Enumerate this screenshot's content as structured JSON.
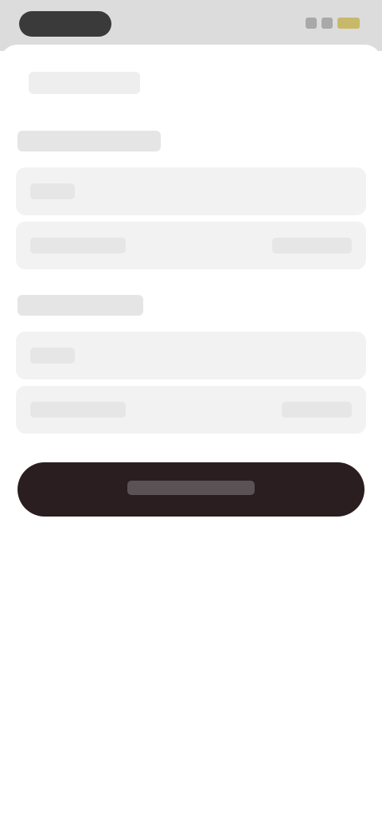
{
  "status_bar": {
    "time": ""
  },
  "top_row": {
    "label": ""
  },
  "sections": [
    {
      "title": "",
      "fields": [
        {
          "label": "",
          "value": ""
        },
        {
          "label": "",
          "value": ""
        }
      ]
    },
    {
      "title": "",
      "fields": [
        {
          "label": "",
          "value": ""
        },
        {
          "label": "",
          "value": ""
        }
      ]
    }
  ],
  "primary_button": {
    "label": ""
  },
  "colors": {
    "button_bg": "#2a1e20",
    "field_bg": "#f2f2f2",
    "status_bg": "#dcdcdc"
  }
}
